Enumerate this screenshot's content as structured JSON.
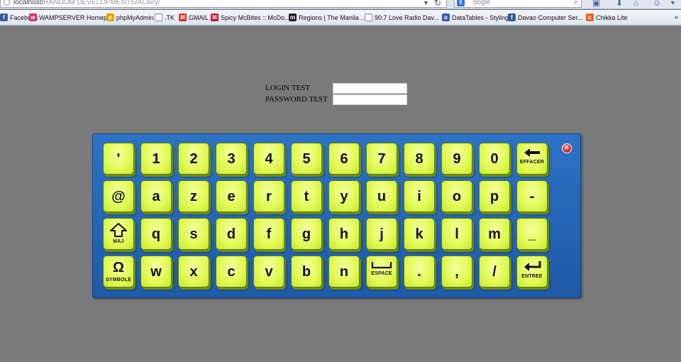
{
  "browser": {
    "url_host": "localhost/",
    "url_path": "RANDOM DEVELOPMENTS/ACkey/",
    "search_placeholder": "oogle",
    "bookmarks": [
      {
        "label": "Facebook",
        "color": "#3b5998",
        "glyph": "f"
      },
      {
        "label": "WAMPSERVER Homep...",
        "color": "#d6307a",
        "glyph": "w"
      },
      {
        "label": "phpMyAdmin",
        "color": "#e8a000",
        "glyph": "p"
      },
      {
        "label": ".TK",
        "color": "",
        "glyph": ""
      },
      {
        "label": "GMAIL",
        "color": "#d93025",
        "glyph": "M"
      },
      {
        "label": "Spicy McBites :: McDo...",
        "color": "#c8102e",
        "glyph": "M"
      },
      {
        "label": "Regions | The Manila ...",
        "color": "#222222",
        "glyph": "m"
      },
      {
        "label": "90.7 Love Radio Dav...",
        "color": "",
        "glyph": ""
      },
      {
        "label": "DataTables - Styling",
        "color": "#3a5bb0",
        "glyph": "o"
      },
      {
        "label": "Davao Computer Ser...",
        "color": "#3b5998",
        "glyph": "f"
      },
      {
        "label": "Chikka Lite",
        "color": "#e3661d",
        "glyph": "c"
      }
    ],
    "more": "»"
  },
  "login": {
    "login_label": "LOGIN TEST",
    "password_label": "PASSWORD TEST"
  },
  "keyboard": {
    "close_glyph": "×",
    "rows": [
      [
        {
          "main": "'"
        },
        {
          "main": "1"
        },
        {
          "main": "2"
        },
        {
          "main": "3"
        },
        {
          "main": "4"
        },
        {
          "main": "5"
        },
        {
          "main": "6"
        },
        {
          "main": "7"
        },
        {
          "main": "8"
        },
        {
          "main": "9"
        },
        {
          "main": "0"
        },
        {
          "glyph": "backspace",
          "sub": "EFFACER"
        }
      ],
      [
        {
          "main": "@"
        },
        {
          "main": "a"
        },
        {
          "main": "z"
        },
        {
          "main": "e"
        },
        {
          "main": "r"
        },
        {
          "main": "t"
        },
        {
          "main": "y"
        },
        {
          "main": "u"
        },
        {
          "main": "i"
        },
        {
          "main": "o"
        },
        {
          "main": "p"
        },
        {
          "main": "-"
        }
      ],
      [
        {
          "glyph": "shift",
          "sub": "MAJ"
        },
        {
          "main": "q"
        },
        {
          "main": "s"
        },
        {
          "main": "d"
        },
        {
          "main": "f"
        },
        {
          "main": "g"
        },
        {
          "main": "h"
        },
        {
          "main": "j"
        },
        {
          "main": "k"
        },
        {
          "main": "l"
        },
        {
          "main": "m"
        },
        {
          "main": "_"
        }
      ],
      [
        {
          "glyph": "Ω",
          "sub": "SYMBOLE"
        },
        {
          "main": "w"
        },
        {
          "main": "x"
        },
        {
          "main": "c"
        },
        {
          "main": "v"
        },
        {
          "main": "b"
        },
        {
          "main": "n"
        },
        {
          "glyph": "space",
          "sub": "ESPACE"
        },
        {
          "main": "."
        },
        {
          "main": ","
        },
        {
          "main": "/"
        },
        {
          "glyph": "enter",
          "sub": "ENTREE"
        }
      ]
    ]
  }
}
